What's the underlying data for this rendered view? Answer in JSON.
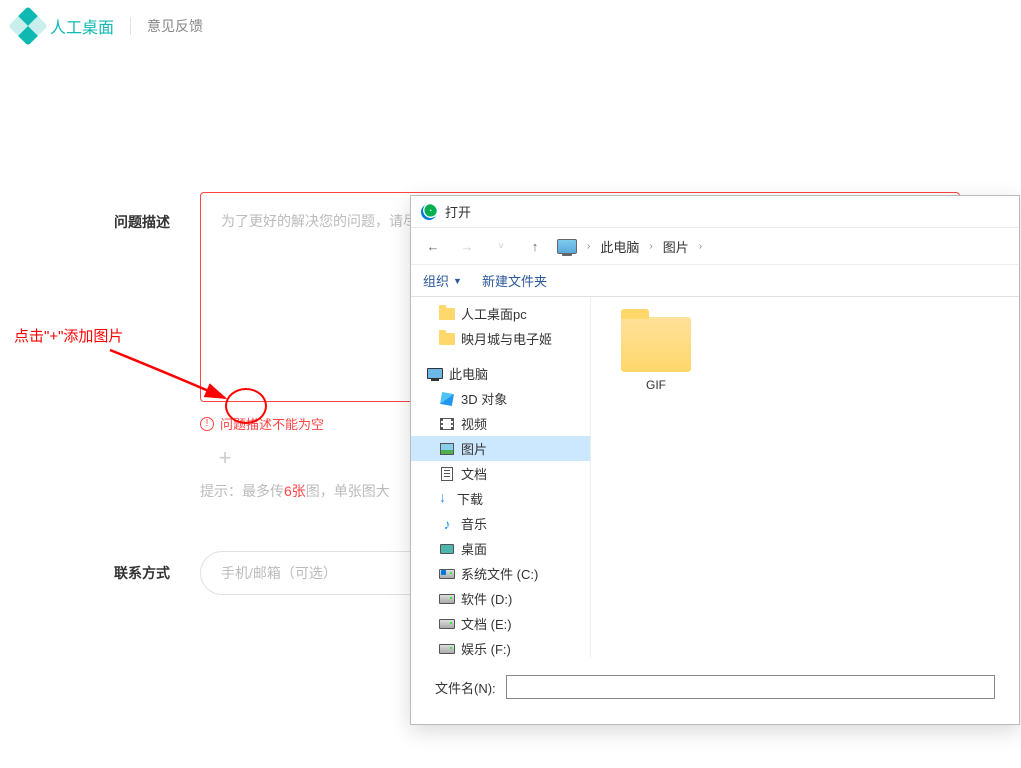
{
  "header": {
    "appName": "人工桌面",
    "subtitle": "意见反馈"
  },
  "form": {
    "descLabel": "问题描述",
    "descPlaceholder": "为了更好的解决您的问题，请尽量提供详细信息（如：上传问题图片等）",
    "error": "问题描述不能为空",
    "hintPrefix": "提示：最多传",
    "hintCount": "6张",
    "hintSuffix": "图，单张图大",
    "contactLabel": "联系方式",
    "contactPlaceholder": "手机/邮箱（可选）"
  },
  "annot": {
    "text": "点击\"+\"添加图片"
  },
  "dialog": {
    "title": "打开",
    "crumb1": "此电脑",
    "crumb2": "图片",
    "toolbar": {
      "org": "组织",
      "newFolder": "新建文件夹"
    },
    "tree": {
      "quick1": "人工桌面pc",
      "quick2": "映月城与电子姬",
      "thisPC": "此电脑",
      "d3": "3D 对象",
      "video": "视频",
      "pictures": "图片",
      "docs": "文档",
      "downloads": "下载",
      "music": "音乐",
      "desktop": "桌面",
      "driveC": "系统文件 (C:)",
      "driveD": "软件 (D:)",
      "driveE": "文档 (E:)",
      "driveF": "娱乐 (F:)"
    },
    "content": {
      "folder1": "GIF"
    },
    "filenameLabel": "文件名(N):"
  }
}
